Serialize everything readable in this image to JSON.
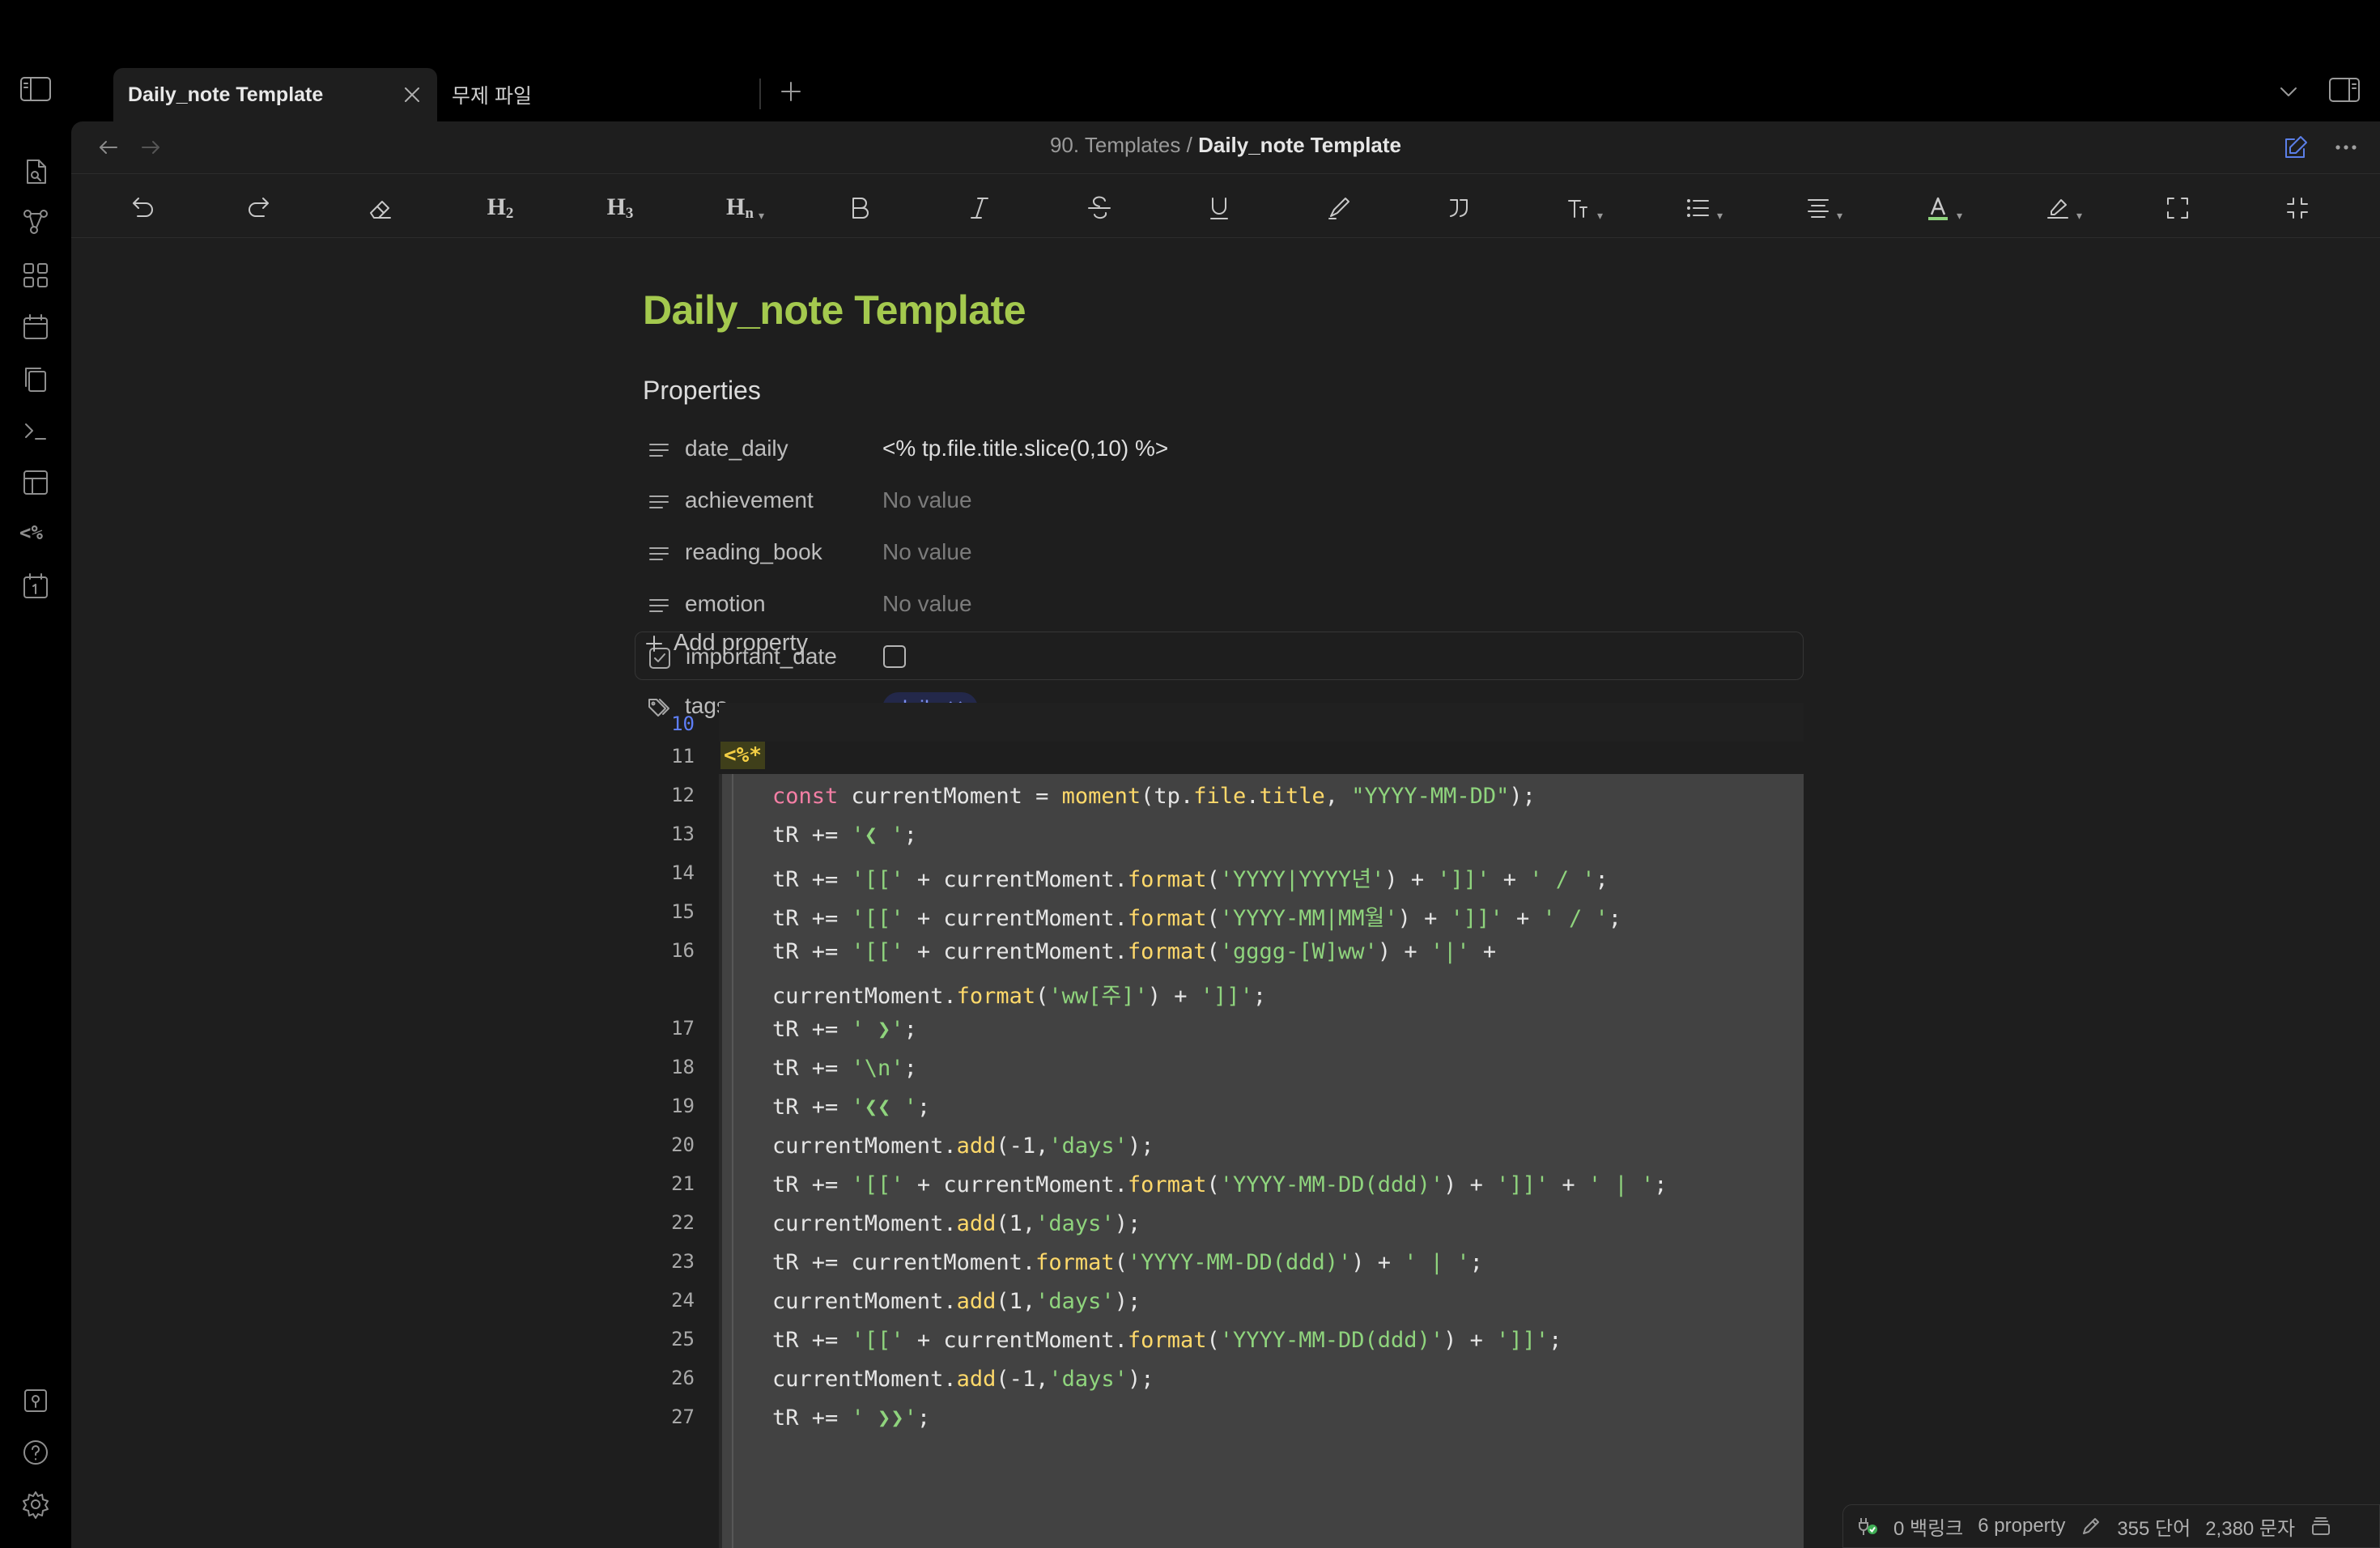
{
  "tabs": [
    {
      "label": "Daily_note Template",
      "active": true
    },
    {
      "label": "무제 파일",
      "active": false
    }
  ],
  "breadcrumb": {
    "folder": "90. Templates",
    "separator": "/",
    "current": "Daily_note Template"
  },
  "toolbar": {
    "h2": "H",
    "h2_sub": "2",
    "h3": "H",
    "h3_sub": "3",
    "hn": "H",
    "hn_sub": "n"
  },
  "note": {
    "title": "Daily_note Template",
    "properties_heading": "Properties",
    "properties": [
      {
        "key": "date_daily",
        "value": "<% tp.file.title.slice(0,10) %>",
        "type": "text",
        "icon": "text-icon"
      },
      {
        "key": "achievement",
        "value": "No value",
        "type": "text",
        "icon": "text-icon"
      },
      {
        "key": "reading_book",
        "value": "No value",
        "type": "text",
        "icon": "text-icon"
      },
      {
        "key": "emotion",
        "value": "No value",
        "type": "text",
        "icon": "text-icon"
      },
      {
        "key": "important_date",
        "value": "",
        "type": "checkbox",
        "icon": "checkbox-icon"
      },
      {
        "key": "tags",
        "value": "daily",
        "type": "tags",
        "icon": "tags-icon"
      }
    ],
    "add_property": "Add property"
  },
  "code": {
    "line_numbers": [
      "10",
      "11",
      "12",
      "13",
      "14",
      "15",
      "16",
      "17",
      "18",
      "19",
      "20",
      "21",
      "22",
      "23",
      "24",
      "25",
      "26",
      "27"
    ],
    "templater_open": "<%*",
    "lines": [
      "const currentMoment = moment(tp.file.title, \"YYYY-MM-DD\");",
      "tR += '❮ ';",
      "tR += '[[' + currentMoment.format('YYYY|YYYY년') + ']]' + ' / ';",
      "tR += '[[' + currentMoment.format('YYYY-MM|MM월') + ']]' + ' / ';",
      "tR += '[[' + currentMoment.format('gggg-[W]ww') + '|' +",
      "currentMoment.format('ww[주]') + ']]';",
      "tR += ' ❯';",
      "tR += '\\n';",
      "tR += '❮❮ ';",
      "currentMoment.add(-1,'days');",
      "tR += '[[' + currentMoment.format('YYYY-MM-DD(ddd)') + ']]' + ' | ';",
      "currentMoment.add(1,'days');",
      "tR += currentMoment.format('YYYY-MM-DD(ddd)') + ' | ';",
      "currentMoment.add(1,'days');",
      "tR += '[[' + currentMoment.format('YYYY-MM-DD(ddd)') + ']]';",
      "currentMoment.add(-1,'days');",
      "tR += ' ❯❯';"
    ]
  },
  "status": {
    "backlinks": "0 백링크",
    "properties": "6 property",
    "words": "355 단어",
    "chars": "2,380 문자"
  },
  "colors": {
    "title": "#a4c94e",
    "accent": "#5e7ef7",
    "keyword": "#f57fa5",
    "function": "#ffd96a",
    "string": "#8fd47d",
    "tag": "#7b8ef0"
  }
}
